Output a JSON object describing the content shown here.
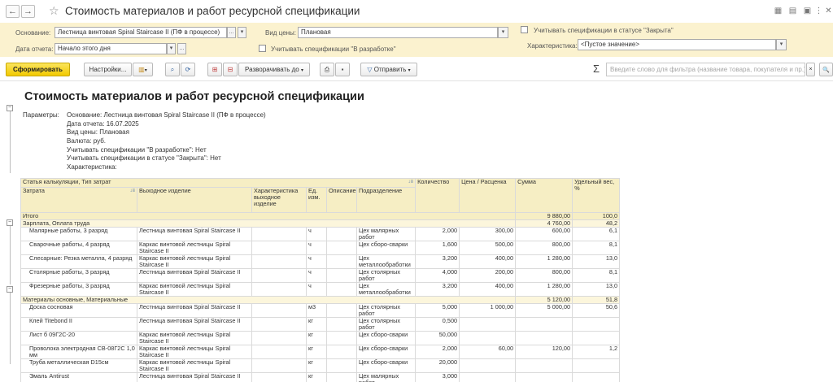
{
  "window": {
    "title": "Стоимость материалов и работ ресурсной спецификации",
    "back": "←",
    "forward": "→",
    "star": "☆",
    "icons": [
      "save-icon",
      "print-icon",
      "link-icon",
      "more-icon",
      "close-icon"
    ],
    "icon_glyphs": [
      "▦",
      "▤",
      "▣",
      "⋮",
      "✕"
    ]
  },
  "params": {
    "osnovanie_label": "Основание:",
    "osnovanie_value": "Лестница винтовая Spiral Staircase II (ПФ в процессе)",
    "data_label": "Дата отчета:",
    "data_value": "Начало этого дня",
    "vid_ceny_label": "Вид цены:",
    "vid_ceny_value": "Плановая",
    "v_razrabotke_label": "Учитывать спецификации \"В разработке\"",
    "zakryta_label": "Учитывать спецификации в статусе \"Закрыта\"",
    "harakteristika_label": "Характеристика:",
    "harakteristika_value": "<Пустое значение>",
    "dots": "...",
    "arrow": "▾",
    "clear": "×"
  },
  "toolbar": {
    "generate": "Сформировать",
    "settings": "Настройки...",
    "expand": "Разворачивать до",
    "send": "Отправить",
    "sigma": "Σ",
    "search_placeholder": "Введите слово для фильтра (название товара, покупателя и пр.)",
    "search_glyph": "🔍",
    "search_clear": "×"
  },
  "report": {
    "title": "Стоимость материалов и работ ресурсной спецификации",
    "params_label": "Параметры:",
    "param_lines": [
      "Основание: Лестница винтовая Spiral Staircase II (ПФ в процессе)",
      "Дата отчета: 16.07.2025",
      "Вид цены: Плановая",
      "Валюта: руб.",
      "Учитывать спецификации \"В разработке\": Нет",
      "Учитывать спецификации в статусе \"Закрыта\": Нет",
      "Характеристика:"
    ],
    "table": {
      "header_group": "Статья калькуляции, Тип затрат",
      "headers": {
        "zatrata": "Затрата",
        "izdelie": "Выходное изделие",
        "harakteristika": "Характеристика выходное изделие",
        "ed": "Ед. изм.",
        "opisanie": "Описание",
        "podrazdelenie": "Подразделение",
        "kolichestvo": "Количество",
        "cena": "Цена / Расценка",
        "summa": "Сумма",
        "ves": "Удельный вес, %"
      },
      "itogo": {
        "label": "Итого",
        "summa": "9 880,00",
        "ves": "100,0"
      },
      "groups": [
        {
          "name": "Зарплата, Оплата труда",
          "summa": "4 760,00",
          "ves": "48,2",
          "rows": [
            {
              "zatrata": "Малярные работы, 3 разряд",
              "izdelie": "Лестница винтовая Spiral Staircase II",
              "ed": "ч",
              "podr": "Цех малярных работ",
              "kol": "2,000",
              "cena": "300,00",
              "summa": "600,00",
              "ves": "6,1"
            },
            {
              "zatrata": "Сварочные работы, 4 разряд",
              "izdelie": "Каркас винтовой лестницы Spiral Staircase II",
              "ed": "ч",
              "podr": "Цех сборо-сварки",
              "kol": "1,600",
              "cena": "500,00",
              "summa": "800,00",
              "ves": "8,1"
            },
            {
              "zatrata": "Слесарные: Резка металла, 4 разряд",
              "izdelie": "Каркас винтовой лестницы Spiral Staircase II",
              "ed": "ч",
              "podr": "Цех металлообработки",
              "kol": "3,200",
              "cena": "400,00",
              "summa": "1 280,00",
              "ves": "13,0"
            },
            {
              "zatrata": "Столярные работы, 3 разряд",
              "izdelie": "Лестница винтовая Spiral Staircase II",
              "ed": "ч",
              "podr": "Цех столярных работ",
              "kol": "4,000",
              "cena": "200,00",
              "summa": "800,00",
              "ves": "8,1"
            },
            {
              "zatrata": "Фрезерные работы, 3 разряд",
              "izdelie": "Каркас винтовой лестницы Spiral Staircase II",
              "ed": "ч",
              "podr": "Цех металлообработки",
              "kol": "3,200",
              "cena": "400,00",
              "summa": "1 280,00",
              "ves": "13,0"
            }
          ]
        },
        {
          "name": "Материалы основные, Материальные",
          "summa": "5 120,00",
          "ves": "51,8",
          "rows": [
            {
              "zatrata": "Доска сосновая",
              "izdelie": "Лестница винтовая Spiral Staircase II",
              "ed": "м3",
              "podr": "Цех столярных работ",
              "kol": "5,000",
              "cena": "1 000,00",
              "summa": "5 000,00",
              "ves": "50,6"
            },
            {
              "zatrata": "Клей Titebond II",
              "izdelie": "Лестница винтовая Spiral Staircase II",
              "ed": "кг",
              "podr": "Цех столярных работ",
              "kol": "0,500",
              "cena": "",
              "summa": "",
              "ves": ""
            },
            {
              "zatrata": "Лист б 09Г2С-20",
              "izdelie": "Каркас винтовой лестницы Spiral Staircase II",
              "ed": "кг",
              "podr": "Цех сборо-сварки",
              "kol": "50,000",
              "cena": "",
              "summa": "",
              "ves": ""
            },
            {
              "zatrata": "Проволока электродная СВ-08Г2С 1,0 мм",
              "izdelie": "Каркас винтовой лестницы Spiral Staircase II",
              "ed": "кг",
              "podr": "Цех сборо-сварки",
              "kol": "2,000",
              "cena": "60,00",
              "summa": "120,00",
              "ves": "1,2"
            },
            {
              "zatrata": "Труба металлическая D15см",
              "izdelie": "Каркас винтовой лестницы Spiral Staircase II",
              "ed": "кг",
              "podr": "Цех сборо-сварки",
              "kol": "20,000",
              "cena": "",
              "summa": "",
              "ves": ""
            },
            {
              "zatrata": "Эмаль Antirust",
              "izdelie": "Лестница винтовая Spiral Staircase II",
              "ed": "кг",
              "podr": "Цех малярных работ",
              "kol": "3,000",
              "cena": "",
              "summa": "",
              "ves": ""
            }
          ]
        }
      ]
    }
  },
  "colors": {
    "params_bg": "#fbf2cf",
    "header_bg": "#f6eec4",
    "group_bg": "#fcf6dc",
    "primary_btn": "#f2c900"
  }
}
